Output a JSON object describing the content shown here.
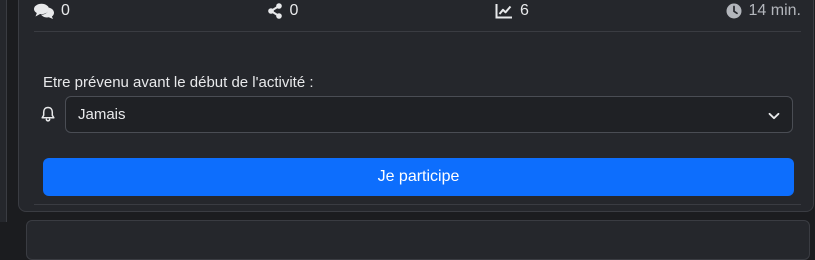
{
  "stats": {
    "comments": "0",
    "shares": "0",
    "views": "6",
    "duration": "14 min."
  },
  "reminder": {
    "label": "Etre prévenu avant le début de l'activité :",
    "selected": "Jamais"
  },
  "participate_button": "Je participe",
  "icons": {
    "comments": "comments-icon",
    "shares": "share-icon",
    "views": "chart-line-icon",
    "duration": "clock-icon",
    "reminder": "bell-icon",
    "select": "chevron-down-icon"
  },
  "colors": {
    "background": "#1b1c1f",
    "card": "#25272c",
    "primary": "#0d6efd",
    "text": "#e8e9eb",
    "muted": "#b3b6bc"
  }
}
